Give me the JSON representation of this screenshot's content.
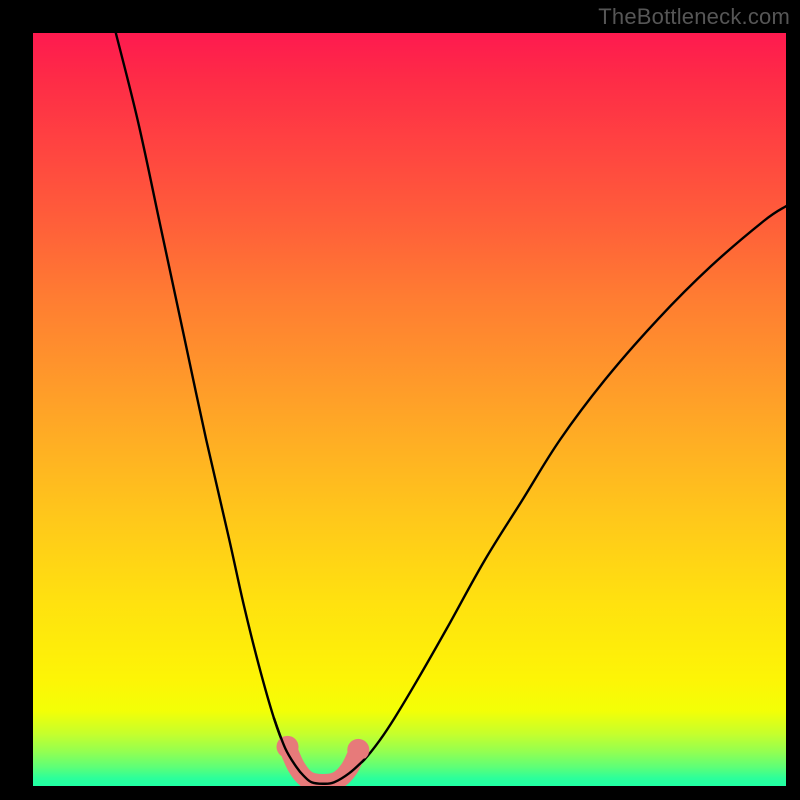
{
  "attribution": "TheBottleneck.com",
  "chart_data": {
    "type": "line",
    "title": "",
    "xlabel": "",
    "ylabel": "",
    "xlim": [
      0,
      100
    ],
    "ylim": [
      0,
      100
    ],
    "series": [
      {
        "name": "bottleneck-curve",
        "description": "V-shaped performance bottleneck curve with flat trough",
        "x": [
          11,
          14,
          17,
          20,
          23,
          26,
          28,
          30,
          32,
          33.5,
          35,
          36,
          37,
          38.5,
          40,
          42,
          44,
          46,
          48,
          51,
          55,
          60,
          65,
          70,
          76,
          83,
          90,
          97,
          100
        ],
        "y": [
          100,
          88,
          74,
          60,
          46,
          33,
          24,
          16,
          9,
          5,
          2.5,
          1.3,
          0.5,
          0.3,
          0.5,
          1.7,
          3.5,
          6,
          9,
          14,
          21,
          30,
          38,
          46,
          54,
          62,
          69,
          75,
          77
        ]
      }
    ],
    "trough_markers": {
      "color": "#e77a7a",
      "points": [
        {
          "x": 33.8,
          "y": 5.2
        },
        {
          "x": 35.0,
          "y": 2.5
        },
        {
          "x": 36.5,
          "y": 0.8
        },
        {
          "x": 38.5,
          "y": 0.4
        },
        {
          "x": 40.5,
          "y": 0.8
        },
        {
          "x": 42.0,
          "y": 2.3
        },
        {
          "x": 43.2,
          "y": 4.8
        }
      ]
    },
    "colors": {
      "curve": "#000000",
      "marker_fill": "#e77a7a",
      "background_top": "#fe1a4f",
      "background_bottom": "#20ffa3",
      "frame": "#000000"
    }
  }
}
